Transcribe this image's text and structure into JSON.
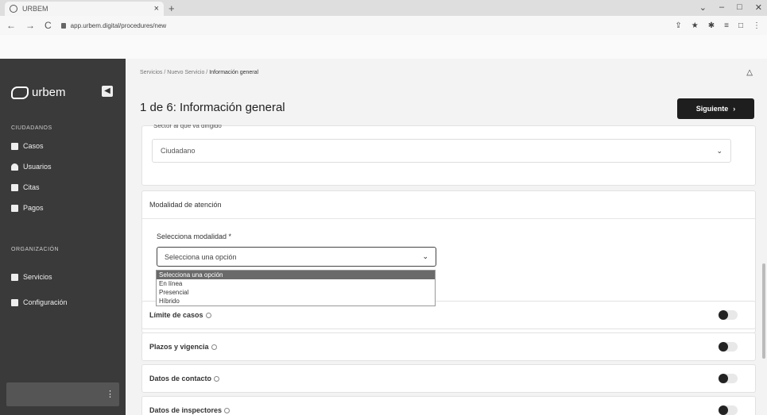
{
  "browser": {
    "tab_title": "URBEM",
    "url": "app.urbem.digital/procedures/new",
    "new_tab": "+",
    "controls": [
      "⌄",
      "–",
      "□",
      "✕"
    ]
  },
  "sidebar": {
    "brand": "urbem",
    "collapse": "◀",
    "sections": [
      {
        "label": "CIUDADANOS",
        "items": [
          {
            "label": "Casos",
            "icon": "folder-icon"
          },
          {
            "label": "Usuarios",
            "icon": "user-icon"
          },
          {
            "label": "Citas",
            "icon": "calendar-icon"
          },
          {
            "label": "Pagos",
            "icon": "payments-icon"
          }
        ]
      },
      {
        "label": "ORGANIZACIÓN",
        "items": [
          {
            "label": "Servicios",
            "icon": "services-icon"
          },
          {
            "label": "Configuración",
            "icon": "gear-icon"
          }
        ]
      }
    ],
    "user_menu": "⋮"
  },
  "header": {
    "breadcrumb": [
      "Servicios",
      "Nuevo Servicio",
      "Información general"
    ],
    "separator": "/"
  },
  "page": {
    "title": "1 de 6: Información general",
    "next_label": "Siguiente",
    "next_arrow": "›"
  },
  "audience": {
    "label_cut": "Sector al que va dirigido",
    "value": "Ciudadano"
  },
  "modality": {
    "header": "Modalidad de atención",
    "field_label": "Selecciona modalidad *",
    "selected": "Selecciona una opción",
    "options": [
      "Selecciona una opción",
      "En línea",
      "Presencial",
      "Híbrido"
    ]
  },
  "sections": [
    {
      "label": "Límite de casos"
    },
    {
      "label": "Plazos y vigencia"
    },
    {
      "label": "Datos de contacto"
    },
    {
      "label": "Datos de inspectores"
    }
  ]
}
